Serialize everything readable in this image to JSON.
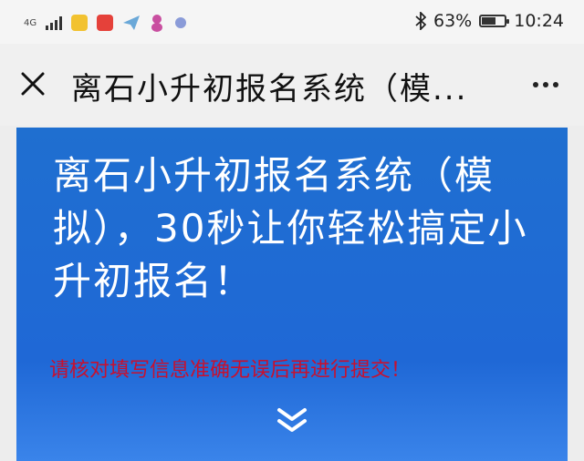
{
  "status_bar": {
    "network_label": "4G",
    "battery_percent": "63%",
    "battery_level": 0.63,
    "time": "10:24",
    "icons": [
      "signal-icon",
      "mail-app-icon",
      "news-app-icon",
      "paper-plane-icon",
      "bird-app-icon",
      "assistant-icon",
      "bluetooth-icon",
      "battery-icon"
    ]
  },
  "title_bar": {
    "title": "离石小升初报名系统（模..."
  },
  "banner": {
    "headline": "离石小升初报名系统（模拟），30秒让你轻松搞定小升初报名！",
    "notice": "请核对填写信息准确无误后再进行提交！",
    "colors": {
      "background": "#1f6fd0",
      "notice": "#c8102e"
    }
  }
}
